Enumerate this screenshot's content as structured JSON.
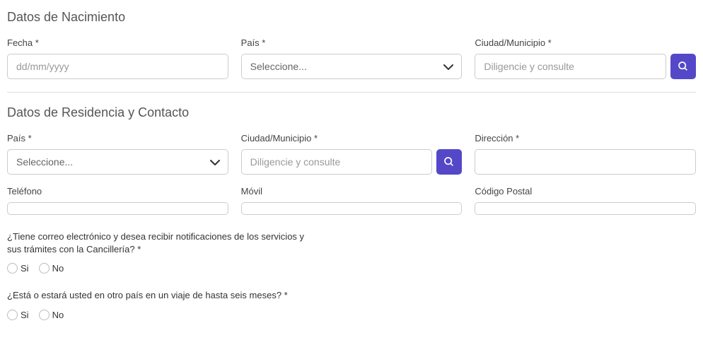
{
  "birth": {
    "title": "Datos de Nacimiento",
    "date_label": "Fecha *",
    "date_placeholder": "dd/mm/yyyy",
    "country_label": "País *",
    "country_placeholder": "Seleccione...",
    "city_label": "Ciudad/Municipio *",
    "city_placeholder": "Diligencie y consulte"
  },
  "residence": {
    "title": "Datos de Residencia y Contacto",
    "country_label": "País *",
    "country_placeholder": "Seleccione...",
    "city_label": "Ciudad/Municipio *",
    "city_placeholder": "Diligencie y consulte",
    "address_label": "Dirección *",
    "phone_label": "Teléfono",
    "mobile_label": "Móvil",
    "postal_label": "Código Postal"
  },
  "questions": {
    "email_question": "¿Tiene correo electrónico y desea recibir notificaciones de los servicios y sus trámites con la Cancillería? *",
    "travel_question": "¿Está o estará usted en otro país en un viaje de hasta seis meses? *",
    "yes": "Si",
    "no": "No"
  }
}
